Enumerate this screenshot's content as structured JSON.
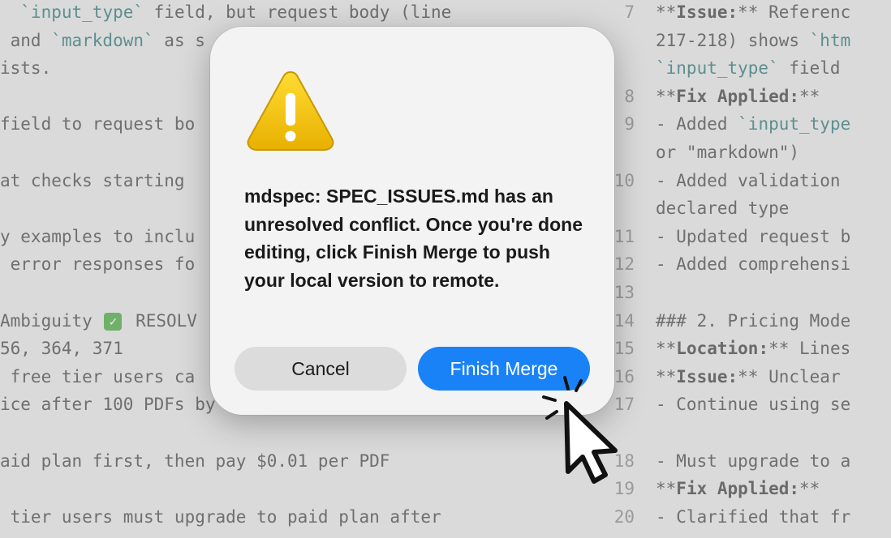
{
  "left_editor": {
    "lines": [
      {
        "segments": [
          {
            "t": "  ",
            "s": ""
          },
          {
            "t": "`input_type`",
            "s": "code"
          },
          {
            "t": " field, but request body (line",
            "s": ""
          }
        ]
      },
      {
        "segments": [
          {
            "t": " and ",
            "s": ""
          },
          {
            "t": "`markdown`",
            "s": "code"
          },
          {
            "t": " as s",
            "s": ""
          }
        ]
      },
      {
        "segments": [
          {
            "t": "ists.",
            "s": ""
          }
        ]
      },
      {
        "segments": [
          {
            "t": "",
            "s": ""
          }
        ]
      },
      {
        "segments": [
          {
            "t": "field to request bo",
            "s": ""
          }
        ]
      },
      {
        "segments": [
          {
            "t": "",
            "s": ""
          }
        ]
      },
      {
        "segments": [
          {
            "t": "at checks starting",
            "s": ""
          }
        ]
      },
      {
        "segments": [
          {
            "t": "",
            "s": ""
          }
        ]
      },
      {
        "segments": [
          {
            "t": "y examples to inclu",
            "s": ""
          }
        ]
      },
      {
        "segments": [
          {
            "t": " error responses fo",
            "s": ""
          }
        ]
      },
      {
        "segments": [
          {
            "t": "",
            "s": ""
          }
        ]
      },
      {
        "segments": [
          {
            "t": "Ambiguity ",
            "s": ""
          },
          {
            "t": "",
            "s": "check"
          },
          {
            "t": " RESOLV",
            "s": ""
          }
        ]
      },
      {
        "segments": [
          {
            "t": "56, 364, 371",
            "s": ""
          }
        ]
      },
      {
        "segments": [
          {
            "t": " free tier users ca",
            "s": ""
          }
        ]
      },
      {
        "segments": [
          {
            "t": "ice after 100 PDFs by",
            "s": ""
          }
        ]
      },
      {
        "segments": [
          {
            "t": "",
            "s": ""
          }
        ]
      },
      {
        "segments": [
          {
            "t": "aid plan first, then pay $0.01 per PDF",
            "s": ""
          }
        ]
      },
      {
        "segments": [
          {
            "t": "",
            "s": ""
          }
        ]
      },
      {
        "segments": [
          {
            "t": " tier users must upgrade to paid plan after",
            "s": ""
          }
        ]
      }
    ]
  },
  "right_editor": {
    "lines": [
      {
        "num": "7",
        "segments": [
          {
            "t": "**",
            "s": ""
          },
          {
            "t": "Issue:",
            "s": "bold"
          },
          {
            "t": "** Referenc",
            "s": ""
          }
        ]
      },
      {
        "num": "",
        "segments": [
          {
            "t": "217-218) shows ",
            "s": ""
          },
          {
            "t": "`htm",
            "s": "code"
          }
        ]
      },
      {
        "num": "",
        "segments": [
          {
            "t": "`input_type`",
            "s": "code"
          },
          {
            "t": " field",
            "s": ""
          }
        ]
      },
      {
        "num": "8",
        "segments": [
          {
            "t": "**",
            "s": ""
          },
          {
            "t": "Fix Applied:",
            "s": "bold"
          },
          {
            "t": "**",
            "s": ""
          }
        ]
      },
      {
        "num": "9",
        "segments": [
          {
            "t": "- Added ",
            "s": ""
          },
          {
            "t": "`input_type",
            "s": "code"
          }
        ]
      },
      {
        "num": "",
        "segments": [
          {
            "t": "or \"markdown\")",
            "s": ""
          }
        ]
      },
      {
        "num": "10",
        "segments": [
          {
            "t": "- Added validation",
            "s": ""
          }
        ]
      },
      {
        "num": "",
        "segments": [
          {
            "t": "declared type",
            "s": ""
          }
        ]
      },
      {
        "num": "11",
        "segments": [
          {
            "t": "- Updated request b",
            "s": ""
          }
        ]
      },
      {
        "num": "12",
        "segments": [
          {
            "t": "- Added comprehensi",
            "s": ""
          }
        ]
      },
      {
        "num": "13",
        "segments": [
          {
            "t": "",
            "s": ""
          }
        ]
      },
      {
        "num": "14",
        "segments": [
          {
            "t": "### 2. Pricing Mode",
            "s": ""
          }
        ]
      },
      {
        "num": "15",
        "segments": [
          {
            "t": "**",
            "s": ""
          },
          {
            "t": "Location:",
            "s": "bold"
          },
          {
            "t": "** Lines",
            "s": ""
          }
        ]
      },
      {
        "num": "16",
        "segments": [
          {
            "t": "**",
            "s": ""
          },
          {
            "t": "Issue:",
            "s": "bold"
          },
          {
            "t": "** Unclear",
            "s": ""
          }
        ]
      },
      {
        "num": "17",
        "segments": [
          {
            "t": "- Continue using se",
            "s": ""
          }
        ]
      },
      {
        "num": "",
        "segments": [
          {
            "t": "",
            "s": ""
          }
        ]
      },
      {
        "num": "18",
        "segments": [
          {
            "t": "- Must upgrade to a",
            "s": ""
          }
        ]
      },
      {
        "num": "19",
        "segments": [
          {
            "t": "**",
            "s": ""
          },
          {
            "t": "Fix Applied:",
            "s": "bold"
          },
          {
            "t": "**",
            "s": ""
          }
        ]
      },
      {
        "num": "20",
        "segments": [
          {
            "t": "- Clarified that fr",
            "s": ""
          }
        ]
      }
    ]
  },
  "dialog": {
    "icon": "warning-triangle-icon",
    "message": "mdspec: SPEC_ISSUES.md has an unresolved conflict. Once you're done editing, click Finish Merge to push your local version to remote.",
    "cancel_label": "Cancel",
    "primary_label": "Finish Merge"
  },
  "colors": {
    "primary_button": "#1a82f7",
    "warning_icon": "#f2c200",
    "backdrop": "#dadada"
  },
  "cursor": {
    "icon": "click-pointer-icon"
  }
}
